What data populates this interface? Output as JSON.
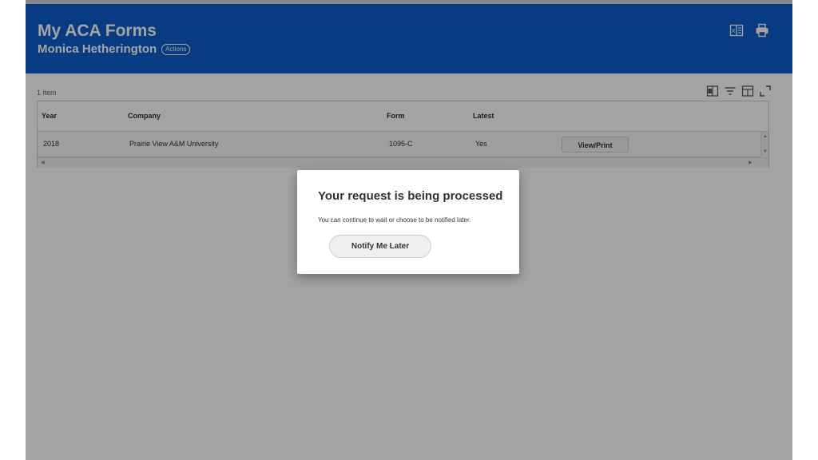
{
  "header": {
    "title": "My ACA Forms",
    "worker_name": "Monica Hetherington",
    "actions_label": "Actions",
    "icons": [
      "export-to-excel-icon",
      "print-icon"
    ]
  },
  "grid": {
    "item_count": "1 item",
    "toolbar_icons": [
      "export-icon",
      "filter-icon",
      "column-layout-icon",
      "fullscreen-icon"
    ],
    "columns": [
      "Year",
      "Company",
      "Form",
      "Latest"
    ],
    "rows": [
      {
        "year": "2018",
        "company": "Prairie View A&M University",
        "form": "1095-C",
        "latest": "Yes",
        "action": "View/Print"
      }
    ]
  },
  "dialog": {
    "title": "Your request is being processed",
    "message": "You can continue to wait or choose to be notified later.",
    "button_label": "Notify Me Later"
  },
  "colors": {
    "header_bg": "#0b5fcc",
    "overlay": "rgba(0,0,0,0.36)"
  }
}
